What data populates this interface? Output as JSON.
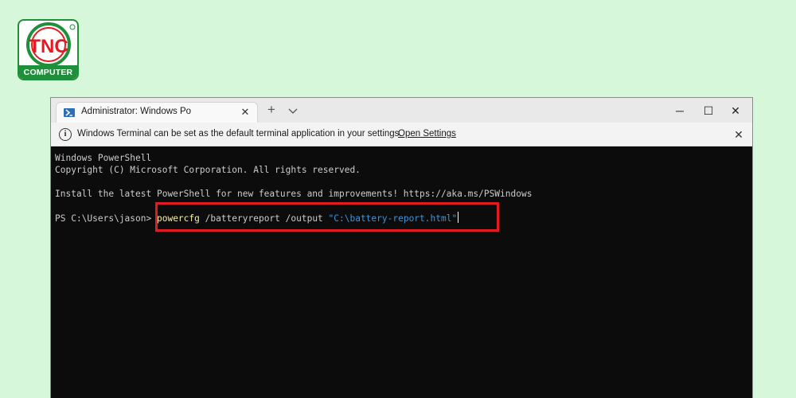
{
  "logo": {
    "mark": "TNC",
    "text": "COMPUTER"
  },
  "window": {
    "tab_title": "Administrator: Windows PowerShell",
    "tab_icon": "powershell-icon",
    "new_tab_symbol": "+",
    "close_symbol": "✕",
    "minimize_symbol": "─",
    "maximize_symbol": "☐"
  },
  "infobar": {
    "message": "Windows Terminal can be set as the default terminal application in your settings.",
    "link": "Open Settings",
    "icon": "info-icon"
  },
  "console": {
    "line1": "Windows PowerShell",
    "line2": "Copyright (C) Microsoft Corporation. All rights reserved.",
    "line3": "Install the latest PowerShell for new features and improvements! https://aka.ms/PSWindows",
    "prompt": "PS C:\\Users\\jason> ",
    "command": "powercfg",
    "args": " /batteryreport /output ",
    "string_arg": "\"C:\\battery-report.html\""
  },
  "colors": {
    "background": "#d6f7d9",
    "brand_green": "#1f8f3b",
    "brand_red": "#e21b23",
    "console_bg": "#0c0c0c",
    "console_text": "#cccccc",
    "command_yellow": "#f9f1a5",
    "string_blue": "#3a96dd",
    "highlight": "#e21b23"
  }
}
